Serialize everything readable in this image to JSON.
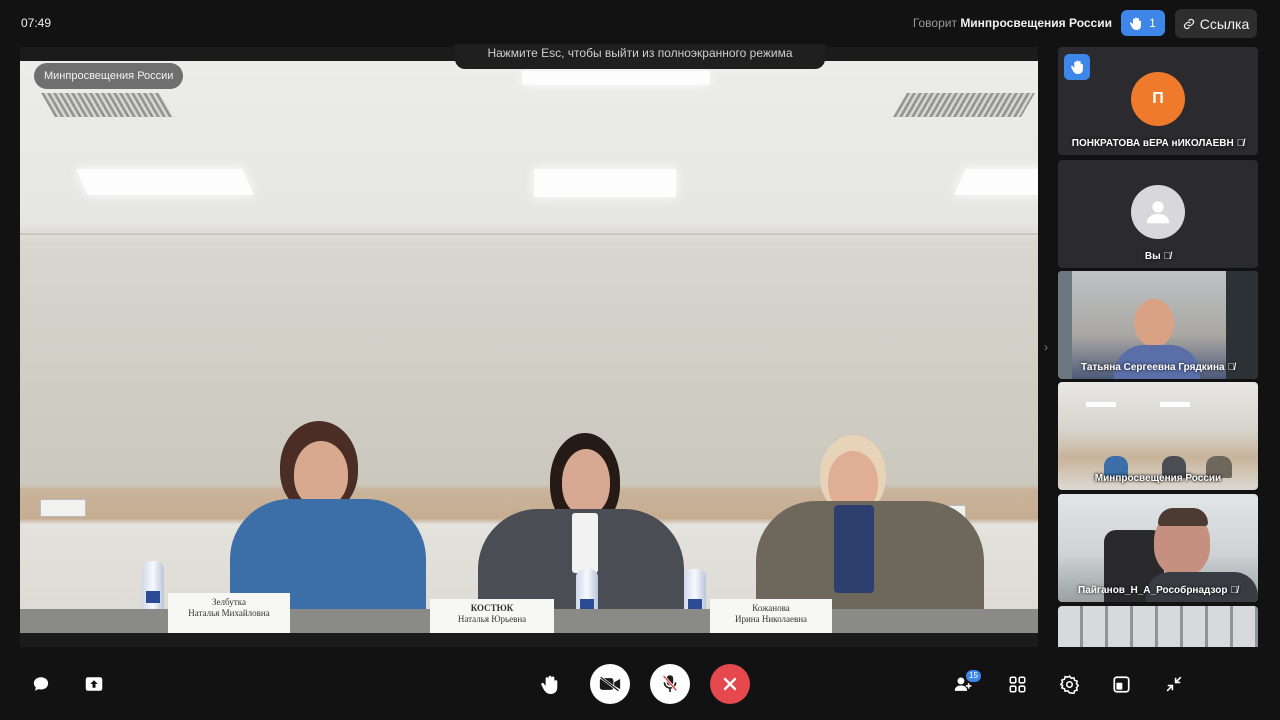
{
  "status": {
    "time": "07:49",
    "speaking_prefix": "Говорит",
    "speaking_name": "Минпросвещения России",
    "raised_hands_count": "1",
    "link_label": "Ссылка"
  },
  "stage": {
    "label": "Минпросвещения России",
    "esc_hint": "Нажмите Esc, чтобы выйти из полноэкранного режима",
    "nameplates": [
      {
        "line1": "Зелбутка",
        "line2": "Наталья Михайловна"
      },
      {
        "line1": "КОСТЮК",
        "line2": "Наталья Юрьевна"
      },
      {
        "line1": "Кожанова",
        "line2": "Ирина Николаевна"
      }
    ]
  },
  "participants": [
    {
      "name": "ПОНКРАТОВА вЕРА нИКОЛАЕВН",
      "avatar_letter": "П",
      "avatar_color": "#f07a2c",
      "hand_raised": true,
      "muted": true
    },
    {
      "name": "Вы",
      "avatar_letter": "",
      "avatar_color": "#d8d8dc",
      "hand_raised": false,
      "muted": true
    },
    {
      "name": "Татьяна Сергеевна Грядкина",
      "muted": true
    },
    {
      "name": "Минпросвещения России",
      "muted": false
    },
    {
      "name": "Пайганов_Н_А_Рособрнадзор",
      "muted": true
    }
  ],
  "controls": {
    "participants_count": "15",
    "icons": [
      "chat-icon",
      "share-screen-icon",
      "raise-hand-icon",
      "camera-off-icon",
      "mic-off-icon",
      "end-call-icon",
      "participants-icon",
      "grid-icon",
      "settings-icon",
      "layout-icon",
      "exit-fullscreen-icon"
    ],
    "colors": {
      "end_call": "#e5484d",
      "accent": "#3e86e8",
      "round_button": "#ffffff"
    }
  }
}
